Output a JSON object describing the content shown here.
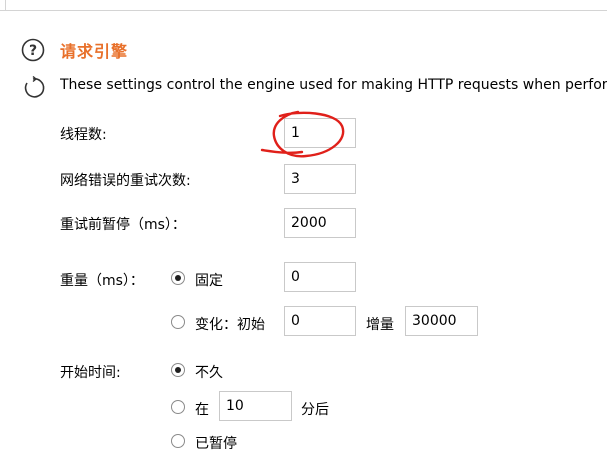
{
  "section": {
    "title": "请求引擎",
    "description": "These settings control the engine used for making HTTP requests when perform"
  },
  "fields": {
    "threads_label": "线程数:",
    "threads_value": "1",
    "retries_label": "网络错误的重试次数:",
    "retries_value": "3",
    "pause_label": "重试前暂停（ms）：",
    "pause_value": "2000"
  },
  "throttle": {
    "label": "重量（ms）：",
    "fixed_label": "固定",
    "fixed_value": "0",
    "fixed_selected": true,
    "variable_label": "变化：初始",
    "variable_initial": "0",
    "increment_label": "增量",
    "increment_value": "30000",
    "variable_selected": false
  },
  "start_time": {
    "label": "开始时间:",
    "immediately_label": "不久",
    "immediately_selected": true,
    "in_label": "在",
    "in_value": "10",
    "minutes_label": "分后",
    "in_selected": false,
    "paused_label": "已暂停",
    "paused_selected": false
  },
  "annotation": {
    "color": "#e0201a"
  },
  "colors": {
    "title": "#e8702a"
  }
}
